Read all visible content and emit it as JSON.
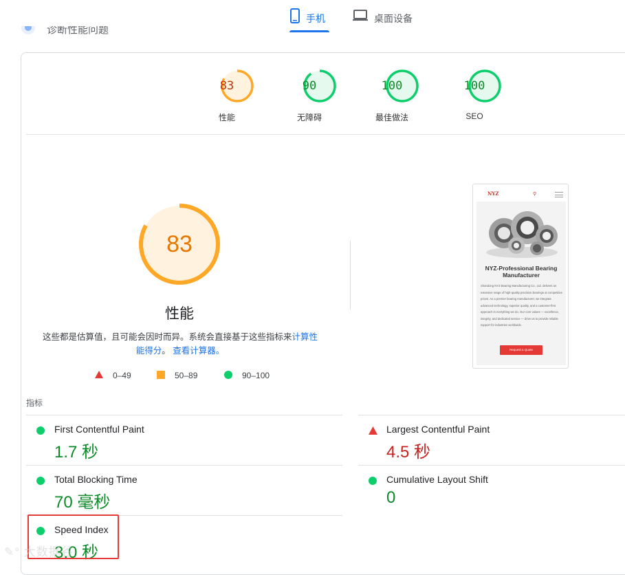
{
  "tabs": [
    {
      "label": "手机",
      "icon": "smartphone-icon",
      "active": true
    },
    {
      "label": "桌面设备",
      "icon": "laptop-icon",
      "active": false
    }
  ],
  "scrolled_header": {
    "text": "诊断性能问题"
  },
  "categories": [
    {
      "score": "83",
      "label": "性能",
      "score_value": 83,
      "status": "average"
    },
    {
      "score": "90",
      "label": "无障碍",
      "score_value": 90,
      "status": "pass"
    },
    {
      "score": "100",
      "label": "最佳做法",
      "score_value": 100,
      "status": "pass"
    },
    {
      "score": "100",
      "label": "SEO",
      "score_value": 100,
      "status": "pass"
    }
  ],
  "performance": {
    "score": "83",
    "score_value": 83,
    "title": "性能",
    "description_text": "这些都是估算值，且可能会因时而异。系统会直接基于这些指标来",
    "description_link1": "计算性能得分",
    "description_sep": "。",
    "description_link2": "查看计算器。"
  },
  "legend": [
    {
      "shape": "triangle",
      "color": "#e53935",
      "range": "0–49"
    },
    {
      "shape": "square",
      "color": "#ffa726",
      "range": "50–89"
    },
    {
      "shape": "circle",
      "color": "#0cce6b",
      "range": "90–100"
    }
  ],
  "thumbnail": {
    "logo": "NYZ",
    "heading": "NYZ-Professional Bearing Manufacturer",
    "paragraph": "Shandong NYZ Bearing Manufacturing Co., Ltd. delivers an extensive range of high-quality precision bearings at competitive prices. As a premier bearing manufacturer, we integrate advanced technology, superior quality, and a customer-first approach in everything we do. Our core values — excellence, integrity, and dedicated service — drive us to provide reliable support for industries worldwide.",
    "button": "Request a Quote"
  },
  "metrics_label": "指标",
  "metrics": [
    {
      "name": "First Contentful Paint",
      "value": "1.7 秒",
      "status": "pass"
    },
    {
      "name": "Largest Contentful Paint",
      "value": "4.5 秒",
      "status": "fail"
    },
    {
      "name": "Total Blocking Time",
      "value": "70 毫秒",
      "status": "pass"
    },
    {
      "name": "Cumulative Layout Shift",
      "value": "0",
      "status": "pass"
    },
    {
      "name": "Speed Index",
      "value": "3.0 秒",
      "status": "pass"
    }
  ],
  "colors": {
    "accent": "#1a73e8",
    "pass": "#0cce6b",
    "average": "#ffa726",
    "fail": "#e53935"
  },
  "watermark": "大数据谷"
}
